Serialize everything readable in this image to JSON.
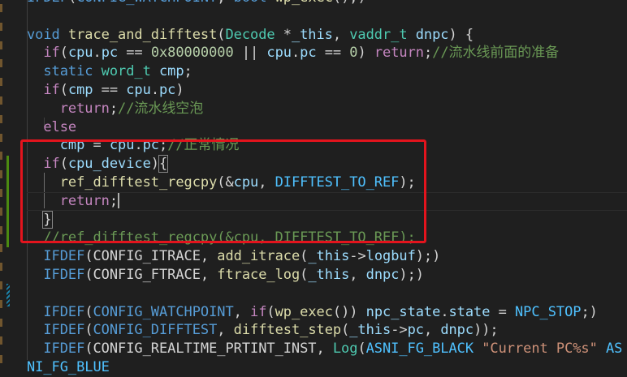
{
  "editor": {
    "lines": [
      [
        [
          "IFDEF",
          "kw"
        ],
        [
          "(",
          ""
        ],
        [
          "CONFIG_WATCHPOINT",
          "kw"
        ],
        [
          ", ",
          ""
        ],
        [
          "bool",
          "kw"
        ],
        [
          " ",
          ""
        ],
        [
          "wp_exec",
          "fn"
        ],
        [
          "();)",
          ""
        ]
      ],
      [],
      [
        [
          "void",
          "kw"
        ],
        [
          " ",
          ""
        ],
        [
          "trace_and_difftest",
          "fn"
        ],
        [
          "(",
          ""
        ],
        [
          "Decode",
          "ty"
        ],
        [
          " *",
          ""
        ],
        [
          "_this",
          "var"
        ],
        [
          ", ",
          ""
        ],
        [
          "vaddr_t",
          "ty"
        ],
        [
          " ",
          ""
        ],
        [
          "dnpc",
          "var"
        ],
        [
          ") {",
          ""
        ]
      ],
      [
        [
          "  ",
          ""
        ],
        [
          "if",
          "ctl"
        ],
        [
          "(",
          ""
        ],
        [
          "cpu",
          "var"
        ],
        [
          ".",
          ""
        ],
        [
          "pc",
          "var"
        ],
        [
          " == ",
          ""
        ],
        [
          "0x80000000",
          "num"
        ],
        [
          " || ",
          ""
        ],
        [
          "cpu",
          "var"
        ],
        [
          ".",
          ""
        ],
        [
          "pc",
          "var"
        ],
        [
          " == ",
          ""
        ],
        [
          "0",
          "num"
        ],
        [
          ") ",
          ""
        ],
        [
          "return",
          "ctl"
        ],
        [
          ";",
          ""
        ],
        [
          "//流水线前面的准备",
          "cm"
        ]
      ],
      [
        [
          "  ",
          ""
        ],
        [
          "static",
          "kw"
        ],
        [
          " ",
          ""
        ],
        [
          "word_t",
          "ty"
        ],
        [
          " ",
          ""
        ],
        [
          "cmp",
          "var"
        ],
        [
          ";",
          ""
        ]
      ],
      [
        [
          "  ",
          ""
        ],
        [
          "if",
          "ctl"
        ],
        [
          "(",
          ""
        ],
        [
          "cmp",
          "var"
        ],
        [
          " == ",
          ""
        ],
        [
          "cpu",
          "var"
        ],
        [
          ".",
          ""
        ],
        [
          "pc",
          "var"
        ],
        [
          ")",
          ""
        ]
      ],
      [
        [
          "    ",
          ""
        ],
        [
          "return",
          "ctl"
        ],
        [
          ";",
          ""
        ],
        [
          "//流水线空泡",
          "cm"
        ]
      ],
      [
        [
          "  ",
          ""
        ],
        [
          "else",
          "ctl"
        ]
      ],
      [
        [
          "    ",
          ""
        ],
        [
          "cmp",
          "var"
        ],
        [
          " = ",
          ""
        ],
        [
          "cpu",
          "var"
        ],
        [
          ".",
          ""
        ],
        [
          "pc",
          "var"
        ],
        [
          ";",
          ""
        ],
        [
          "//正常情况",
          "cm"
        ]
      ],
      [
        [
          "  ",
          ""
        ],
        [
          "if",
          "ctl"
        ],
        [
          "(",
          ""
        ],
        [
          "cpu_device",
          "var"
        ],
        [
          ")",
          ""
        ],
        [
          "{",
          "brk"
        ]
      ],
      [
        [
          "    ",
          ""
        ],
        [
          "ref_difftest_regcpy",
          "fn"
        ],
        [
          "(&",
          ""
        ],
        [
          "cpu",
          "var"
        ],
        [
          ", ",
          ""
        ],
        [
          "DIFFTEST_TO_REF",
          "mac"
        ],
        [
          ");",
          ""
        ]
      ],
      [
        [
          "    ",
          ""
        ],
        [
          "return",
          "ctl"
        ],
        [
          ";",
          ""
        ]
      ],
      [
        [
          "  ",
          ""
        ],
        [
          "}",
          "brk"
        ]
      ],
      [
        [
          "  ",
          ""
        ],
        [
          "//ref_difftest_regcpy(&cpu, DIFFTEST_TO_REF);",
          "cm"
        ]
      ],
      [
        [
          "  ",
          ""
        ],
        [
          "IFDEF",
          "kw"
        ],
        [
          "(",
          ""
        ],
        [
          "CONFIG_ITRACE",
          "pl"
        ],
        [
          ", ",
          ""
        ],
        [
          "add_itrace",
          "fn"
        ],
        [
          "(",
          ""
        ],
        [
          "_this",
          "var"
        ],
        [
          "->",
          ""
        ],
        [
          "logbuf",
          "var"
        ],
        [
          ");)",
          ""
        ]
      ],
      [
        [
          "  ",
          ""
        ],
        [
          "IFDEF",
          "kw"
        ],
        [
          "(",
          ""
        ],
        [
          "CONFIG_FTRACE",
          "pl"
        ],
        [
          ", ",
          ""
        ],
        [
          "ftrace_log",
          "fn"
        ],
        [
          "(",
          ""
        ],
        [
          "_this",
          "var"
        ],
        [
          ", ",
          ""
        ],
        [
          "dnpc",
          "var"
        ],
        [
          ");)",
          ""
        ]
      ],
      [],
      [
        [
          "  ",
          ""
        ],
        [
          "IFDEF",
          "kw"
        ],
        [
          "(",
          ""
        ],
        [
          "CONFIG_WATCHPOINT",
          "kw"
        ],
        [
          ", ",
          ""
        ],
        [
          "if",
          "ctl"
        ],
        [
          "(",
          ""
        ],
        [
          "wp_exec",
          "fn"
        ],
        [
          "()) ",
          ""
        ],
        [
          "npc_state",
          "var"
        ],
        [
          ".",
          ""
        ],
        [
          "state",
          "var"
        ],
        [
          " = ",
          ""
        ],
        [
          "NPC_STOP",
          "mac"
        ],
        [
          ";)",
          ""
        ]
      ],
      [
        [
          "  ",
          ""
        ],
        [
          "IFDEF",
          "kw"
        ],
        [
          "(",
          ""
        ],
        [
          "CONFIG_DIFFTEST",
          "kw"
        ],
        [
          ", ",
          ""
        ],
        [
          "difftest_step",
          "fn"
        ],
        [
          "(",
          ""
        ],
        [
          "_this",
          "var"
        ],
        [
          "->",
          ""
        ],
        [
          "pc",
          "var"
        ],
        [
          ", ",
          ""
        ],
        [
          "dnpc",
          "var"
        ],
        [
          "));",
          ""
        ]
      ],
      [
        [
          "  ",
          ""
        ],
        [
          "IFDEF",
          "kw"
        ],
        [
          "(",
          ""
        ],
        [
          "CONFIG_REALTIME_PRTINT_INST",
          "pl"
        ],
        [
          ", ",
          ""
        ],
        [
          "Log",
          "ty"
        ],
        [
          "(",
          ""
        ],
        [
          "ASNI_FG_BLACK",
          "mac"
        ],
        [
          " ",
          ""
        ],
        [
          "\"Current PC%s\"",
          "str"
        ],
        [
          " ",
          ""
        ],
        [
          "ASNI_FG_BLUE",
          "mac"
        ]
      ]
    ],
    "cursor_line": 11
  }
}
